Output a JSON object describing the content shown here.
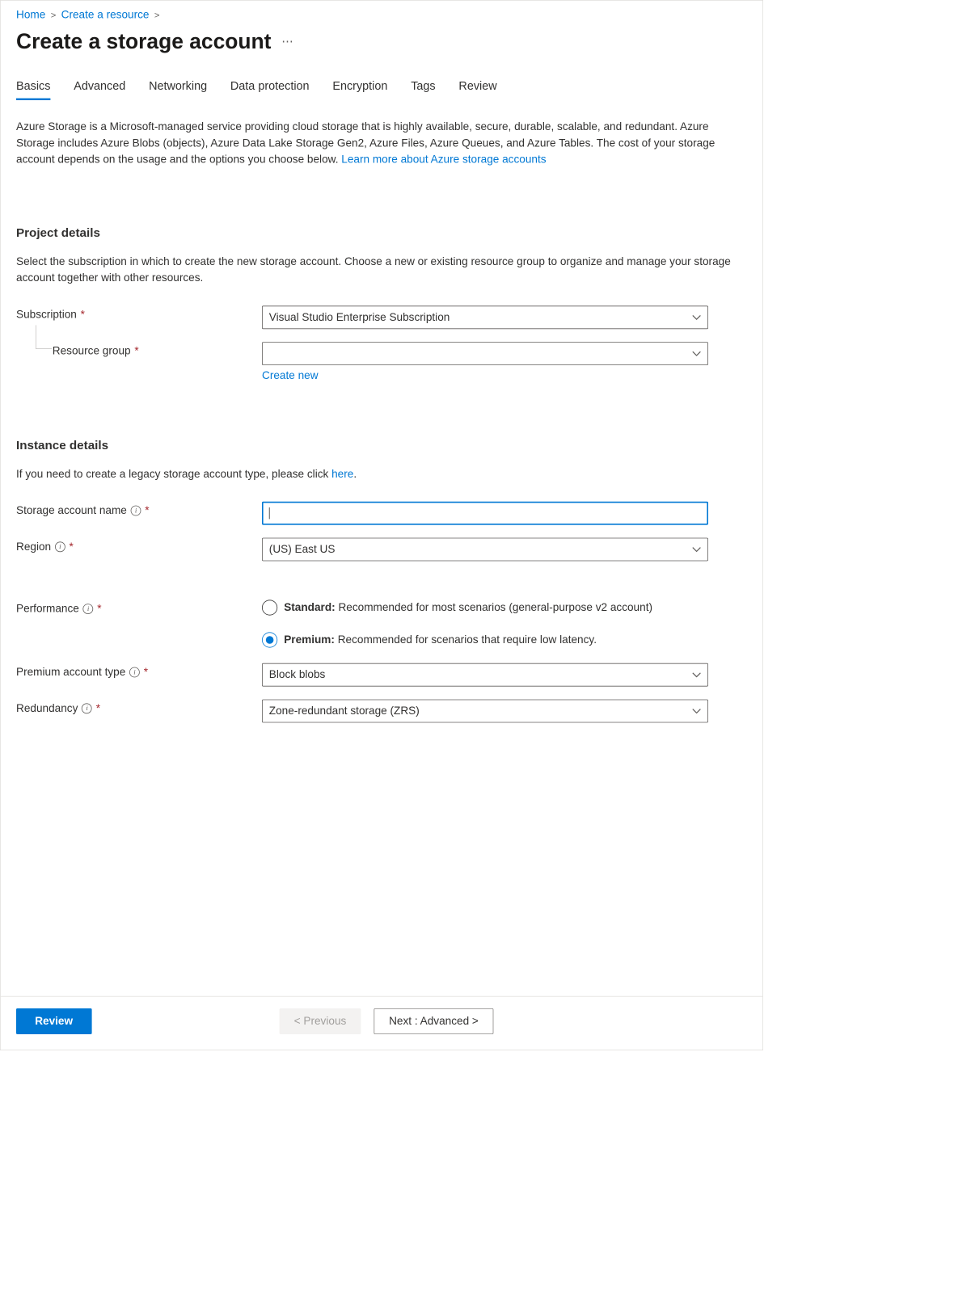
{
  "breadcrumb": {
    "home": "Home",
    "create_resource": "Create a resource"
  },
  "title": "Create a storage account",
  "tabs": {
    "basics": "Basics",
    "advanced": "Advanced",
    "networking": "Networking",
    "data_protection": "Data protection",
    "encryption": "Encryption",
    "tags": "Tags",
    "review": "Review"
  },
  "intro_text": "Azure Storage is a Microsoft-managed service providing cloud storage that is highly available, secure, durable, scalable, and redundant. Azure Storage includes Azure Blobs (objects), Azure Data Lake Storage Gen2, Azure Files, Azure Queues, and Azure Tables. The cost of your storage account depends on the usage and the options you choose below. ",
  "intro_link": "Learn more about Azure storage accounts",
  "project_details": {
    "heading": "Project details",
    "desc": "Select the subscription in which to create the new storage account. Choose a new or existing resource group to organize and manage your storage account together with other resources.",
    "subscription_label": "Subscription",
    "subscription_value": "Visual Studio Enterprise Subscription",
    "resource_group_label": "Resource group",
    "resource_group_value": "",
    "create_new": "Create new"
  },
  "instance_details": {
    "heading": "Instance details",
    "desc_prefix": "If you need to create a legacy storage account type, please click ",
    "desc_link": "here",
    "desc_suffix": ".",
    "storage_name_label": "Storage account name",
    "storage_name_value": "",
    "region_label": "Region",
    "region_value": "(US) East US",
    "performance_label": "Performance",
    "perf_standard_bold": "Standard:",
    "perf_standard_rest": " Recommended for most scenarios (general-purpose v2 account)",
    "perf_premium_bold": "Premium:",
    "perf_premium_rest": " Recommended for scenarios that require low latency.",
    "premium_type_label": "Premium account type",
    "premium_type_value": "Block blobs",
    "redundancy_label": "Redundancy",
    "redundancy_value": "Zone-redundant storage (ZRS)"
  },
  "footer": {
    "review": "Review",
    "previous": "< Previous",
    "next": "Next : Advanced >"
  }
}
